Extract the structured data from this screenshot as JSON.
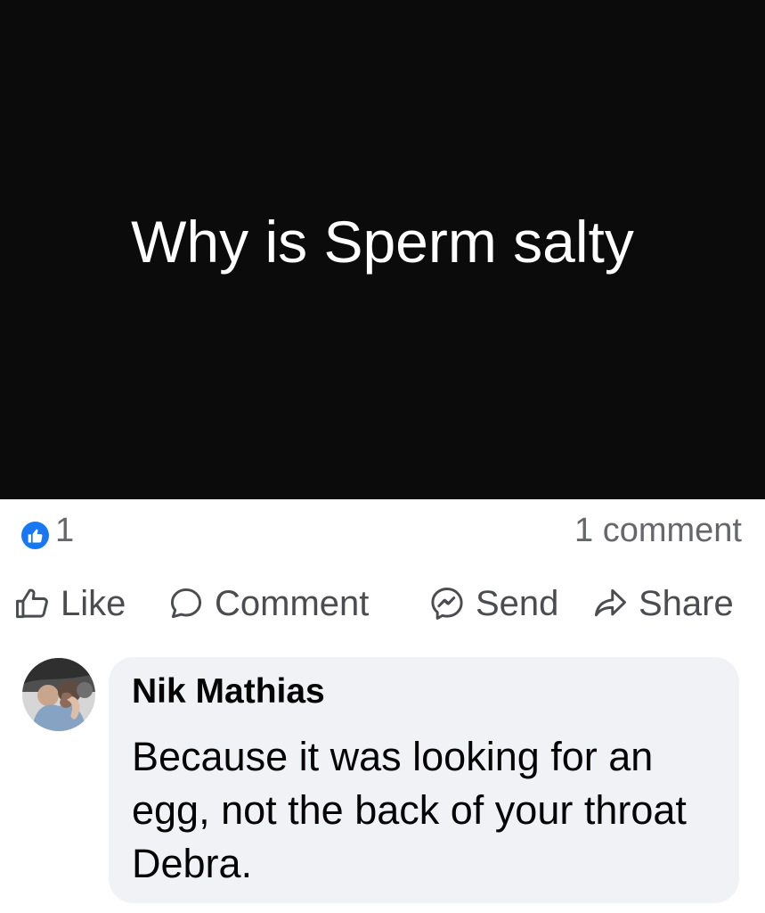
{
  "post": {
    "text": "Why is Sperm salty"
  },
  "stats": {
    "like_count": "1",
    "comment_count": "1 comment"
  },
  "actions": {
    "like": "Like",
    "comment": "Comment",
    "send": "Send",
    "share": "Share"
  },
  "comment": {
    "author": "Nik Mathias",
    "text": "Because it was looking for an egg, not the back of your throat Debra."
  },
  "colors": {
    "post_background": "#0b0b0b",
    "post_text": "#ffffff",
    "like_badge": "#1877f2",
    "comment_bubble": "#f0f2f5",
    "muted_text": "#65676b"
  },
  "icons": {
    "like_badge": "thumbs-up-badge-icon",
    "like": "thumbs-up-outline-icon",
    "comment": "speech-bubble-icon",
    "send": "messenger-icon",
    "share": "share-arrow-icon"
  }
}
